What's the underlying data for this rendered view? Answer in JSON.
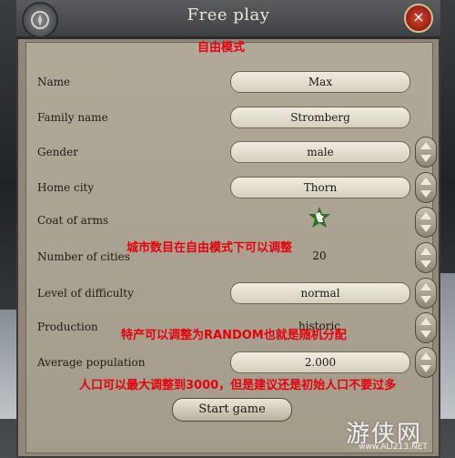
{
  "window": {
    "title": "Free play",
    "close_icon": "×"
  },
  "annotations": {
    "mode": "自由模式",
    "cities": "城市数目在自由模式下可以调整",
    "production": "特产可以调整为RANDOM也就是随机分配",
    "population": "人口可以最大调整到3000，但是建议还是初始人口不要过多"
  },
  "rows": {
    "name": {
      "label": "Name",
      "value": "Max"
    },
    "family": {
      "label": "Family name",
      "value": "Stromberg"
    },
    "gender": {
      "label": "Gender",
      "value": "male"
    },
    "home": {
      "label": "Home city",
      "value": "Thorn"
    },
    "coat": {
      "label": "Coat of arms"
    },
    "cities": {
      "label": "Number of cities",
      "value": "20"
    },
    "difficulty": {
      "label": "Level of difficulty",
      "value": "normal",
      "info": "i"
    },
    "production": {
      "label": "Production",
      "value": "historic"
    },
    "population": {
      "label": "Average population",
      "value": "2.000",
      "info": "i"
    }
  },
  "start_button": "Start game",
  "watermark": {
    "text": "游侠网",
    "sub": "www.ALI213.NET"
  },
  "colors": {
    "annotation": "#e8000b",
    "panel": "#a49c8b",
    "info": "#3f8f1f"
  }
}
